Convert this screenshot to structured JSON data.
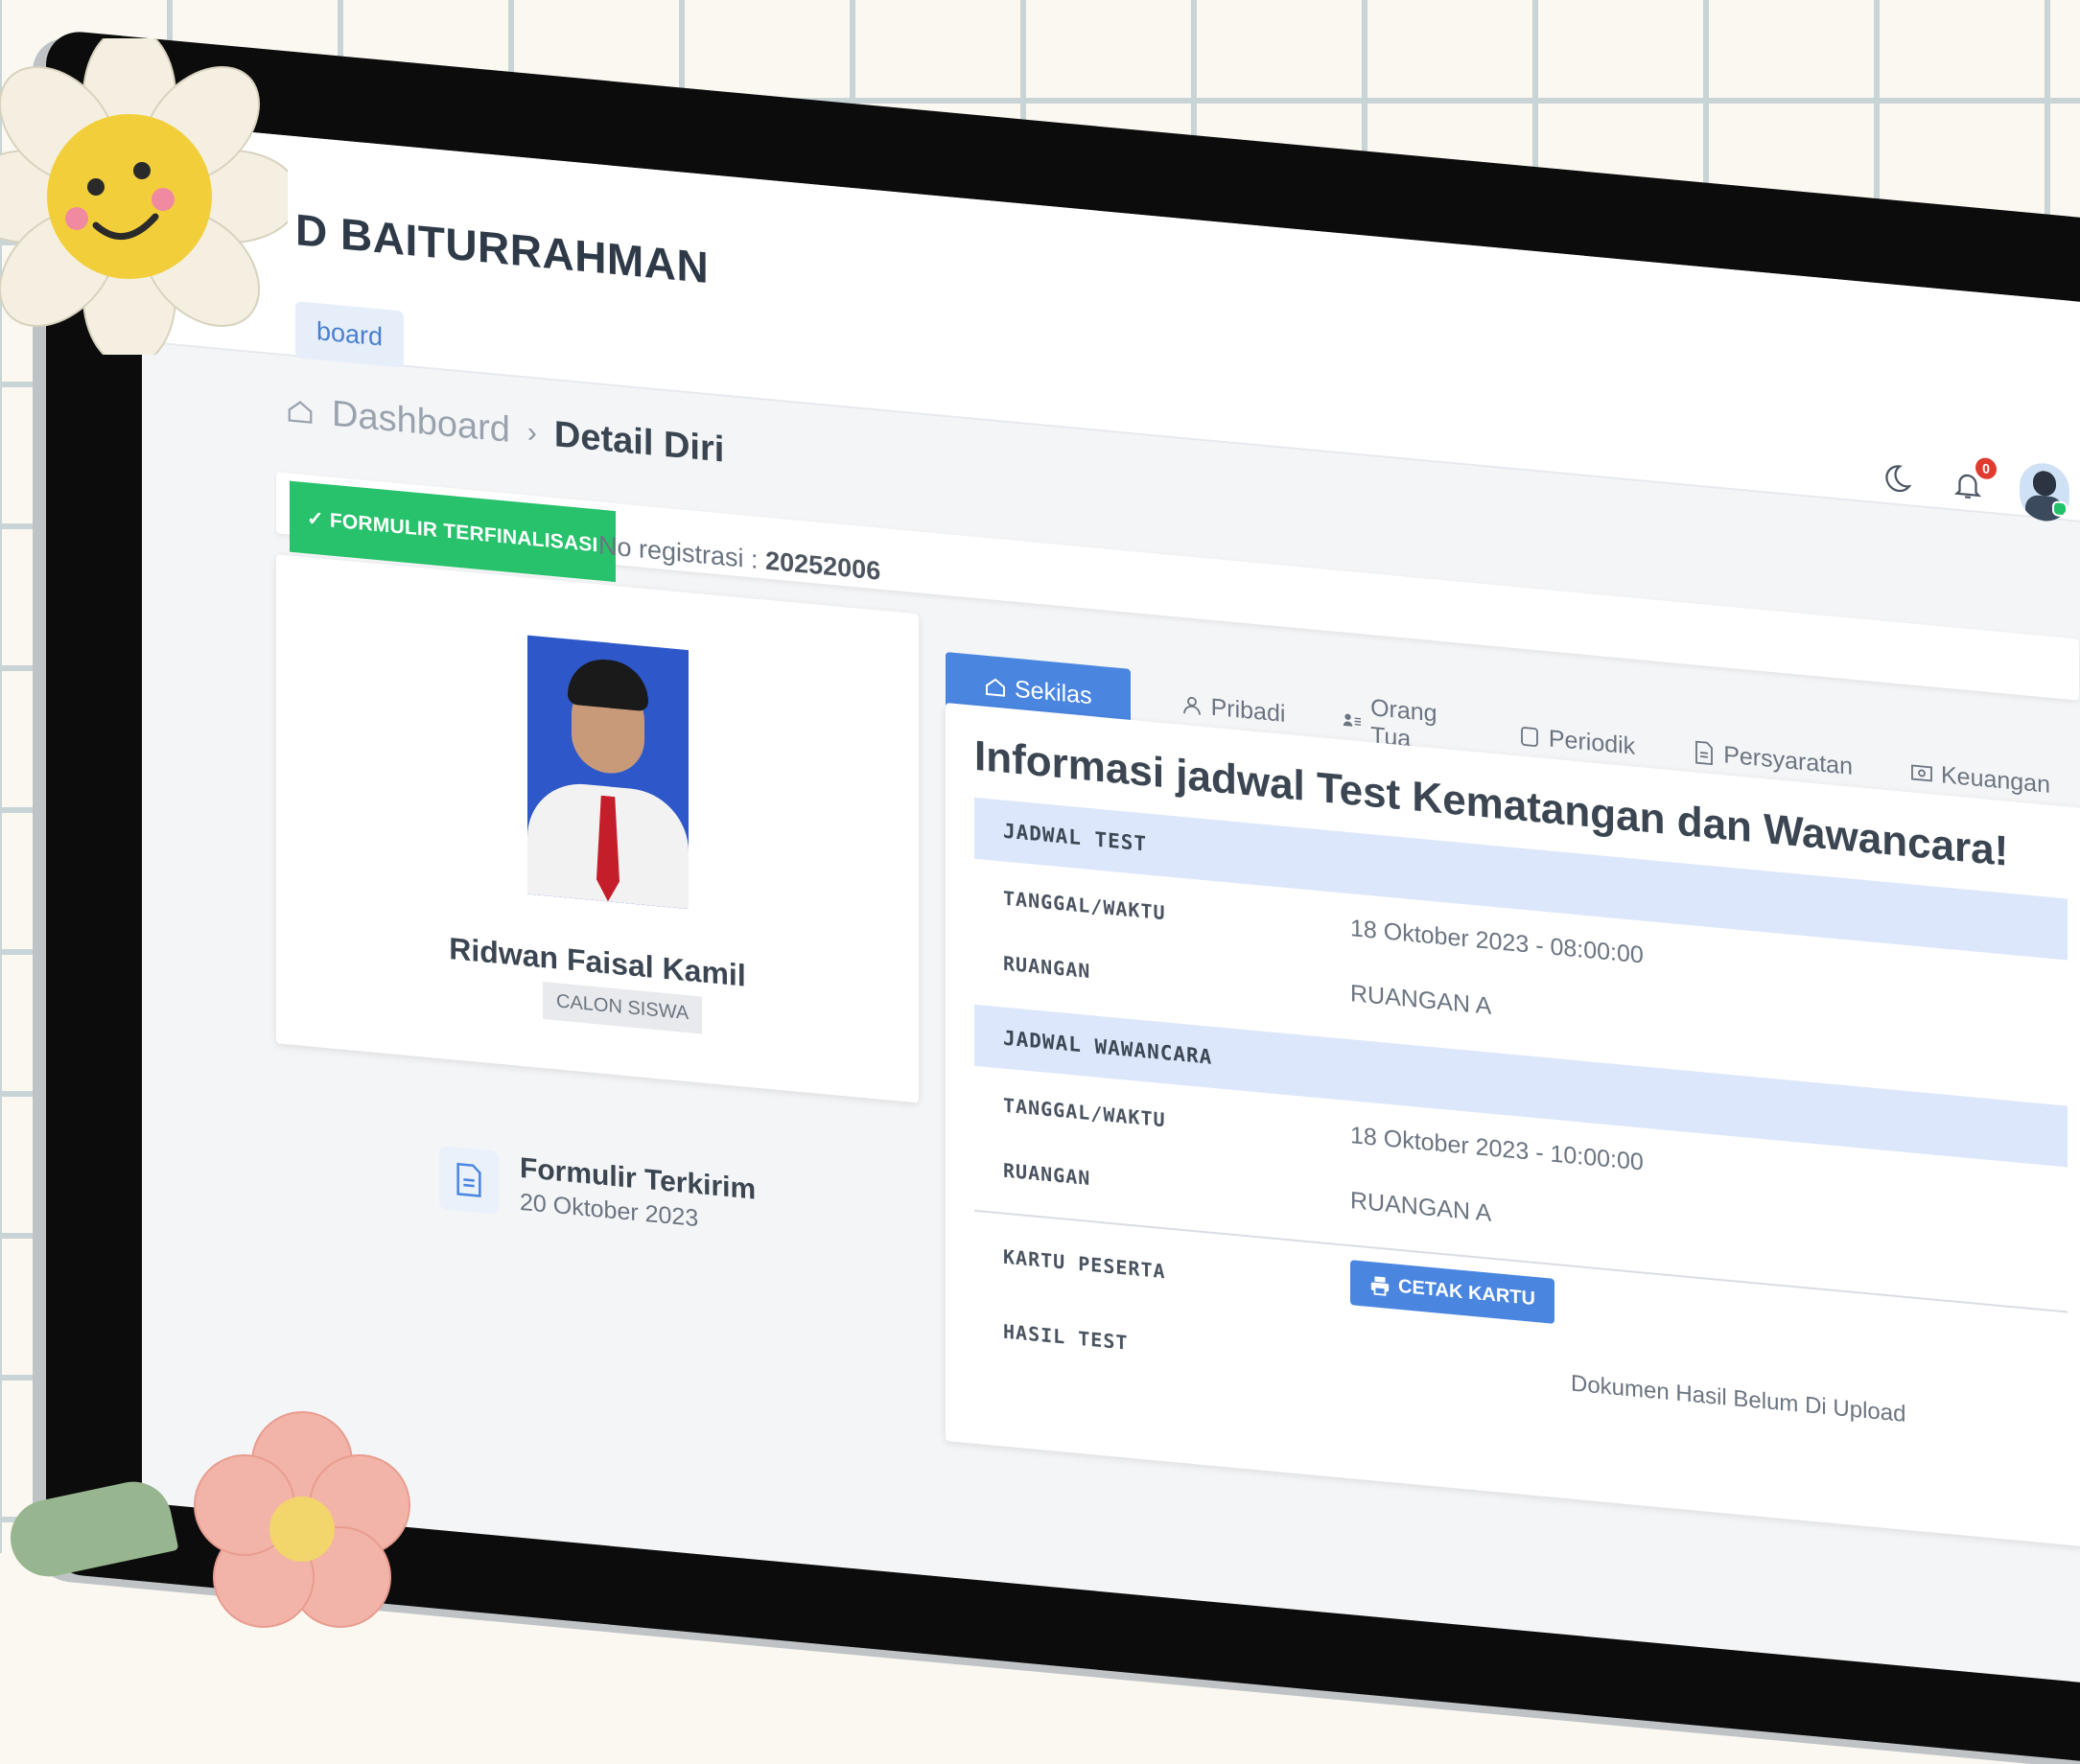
{
  "app": {
    "brand": "D BAITURRAHMAN",
    "nav_label": "board"
  },
  "topbar": {
    "notification_count": "0"
  },
  "breadcrumb": {
    "parent": "Dashboard",
    "current": "Detail Diri"
  },
  "status": {
    "badge": "✓ FORMULIR TERFINALISASI",
    "reg_label": "No registrasi :",
    "reg_number": "20252006"
  },
  "profile": {
    "name": "Ridwan Faisal Kamil",
    "role": "CALON SISWA",
    "form_title": "Formulir Terkirim",
    "form_date": "20 Oktober 2023"
  },
  "tabs": [
    {
      "label": "Sekilas",
      "icon": "home-icon",
      "active": true
    },
    {
      "label": "Pribadi",
      "icon": "user-icon",
      "active": false
    },
    {
      "label": "Orang Tua",
      "icon": "parents-icon",
      "active": false
    },
    {
      "label": "Periodik",
      "icon": "square-icon",
      "active": false
    },
    {
      "label": "Persyaratan",
      "icon": "file-icon",
      "active": false
    },
    {
      "label": "Keuangan",
      "icon": "money-icon",
      "active": false
    }
  ],
  "content": {
    "title": "Informasi jadwal Test Kematangan dan Wawancara!",
    "test_section": "JADWAL TEST",
    "test_datetime_label": "TANGGAL/WAKTU",
    "test_datetime": "18 Oktober 2023 - 08:00:00",
    "test_room_label": "RUANGAN",
    "test_room": "RUANGAN A",
    "interview_section": "JADWAL WAWANCARA",
    "interview_datetime_label": "TANGGAL/WAKTU",
    "interview_datetime": "18 Oktober 2023 - 10:00:00",
    "interview_room_label": "RUANGAN",
    "interview_room": "RUANGAN A",
    "card_label": "KARTU PESERTA",
    "print_button": "CETAK KARTU",
    "result_label": "HASIL TEST",
    "result_value": "Dokumen Hasil Belum Di Upload"
  },
  "colors": {
    "primary": "#4a86e0",
    "success": "#27c26b",
    "section_bg": "#dde7fb",
    "badge_red": "#e03b2f"
  }
}
